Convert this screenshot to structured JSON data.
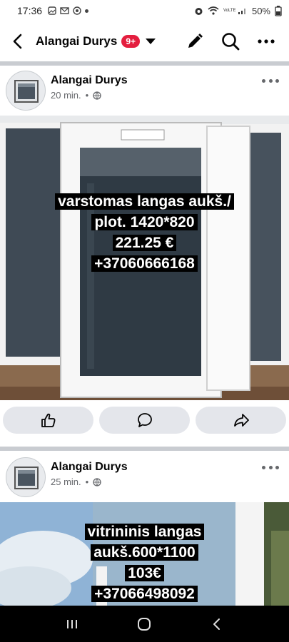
{
  "status": {
    "time": "17:36",
    "battery": "50%",
    "network": "VoLTE"
  },
  "header": {
    "title": "Alangai Durys",
    "badge": "9+"
  },
  "posts": [
    {
      "author": "Alangai Durys",
      "time": "20 min.",
      "separator": "•",
      "caption": [
        "varstomas langas aukš./",
        "plot. 1420*820",
        "221.25 €",
        "+37060666168"
      ]
    },
    {
      "author": "Alangai Durys",
      "time": "25 min.",
      "separator": "•",
      "caption": [
        "vitrininis langas",
        "aukš.600*1100",
        "103€",
        "+37066498092"
      ]
    }
  ],
  "colors": {
    "badge": "#e41e3f",
    "action_bg": "#e4e6eb",
    "divider": "#c9ccd1",
    "secondary_text": "#65676b"
  },
  "icons": {
    "back": "chevron-left-icon",
    "edit": "pencil-icon",
    "search": "search-icon",
    "more": "more-dots-icon",
    "like": "thumbs-up-icon",
    "comment": "comment-bubble-icon",
    "share": "share-arrow-icon",
    "globe": "globe-icon"
  }
}
